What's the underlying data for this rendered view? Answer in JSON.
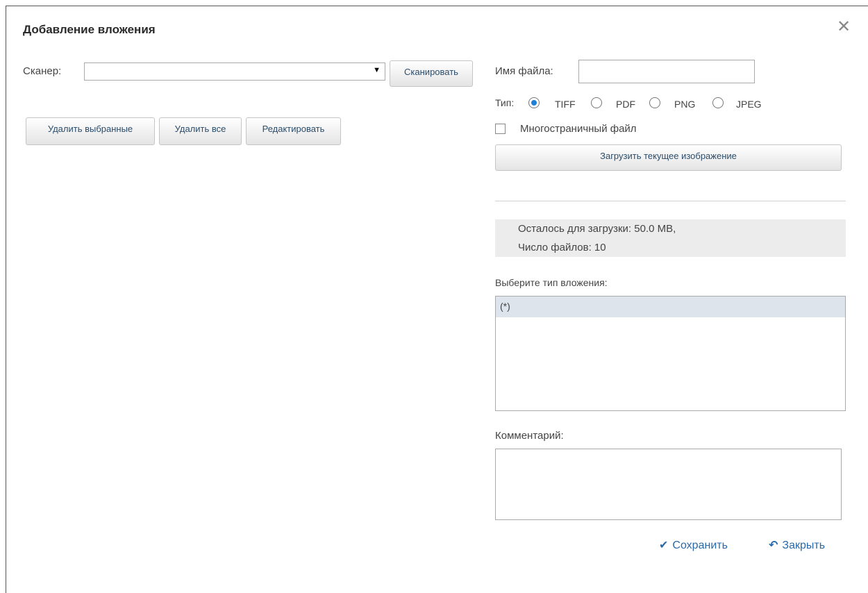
{
  "dialog": {
    "title": "Добавление вложения",
    "close_icon": "close-icon"
  },
  "scanner": {
    "label": "Сканер:",
    "selected": "",
    "scan_button": "Сканировать"
  },
  "toolbar": {
    "delete_selected": "Удалить выбранные",
    "delete_all": "Удалить все",
    "edit": "Редактировать"
  },
  "file": {
    "name_label": "Имя файла:",
    "name_value": "",
    "type_label": "Тип:",
    "types": [
      "TIFF",
      "PDF",
      "PNG",
      "JPEG"
    ],
    "selected_type": "TIFF",
    "multipage_label": "Многостраничный файл",
    "multipage_checked": false,
    "upload_button": "Загрузить текущее изображение"
  },
  "quota": {
    "remaining": "Осталось для загрузки:  50.0 MB,",
    "files_count": "Число файлов:  10"
  },
  "attachment_type": {
    "label": "Выберите тип вложения:",
    "items": [
      "(*)"
    ],
    "selected": "(*)"
  },
  "comment": {
    "label": "Комментарий:",
    "value": ""
  },
  "actions": {
    "save": "Сохранить",
    "save_icon": "checkmark-icon",
    "close": "Закрыть",
    "close_icon": "undo-icon"
  },
  "colors": {
    "accent": "#1e7fd6",
    "link": "#2a6aa8",
    "selection": "#dde4ec",
    "info_background": "#ececec"
  }
}
